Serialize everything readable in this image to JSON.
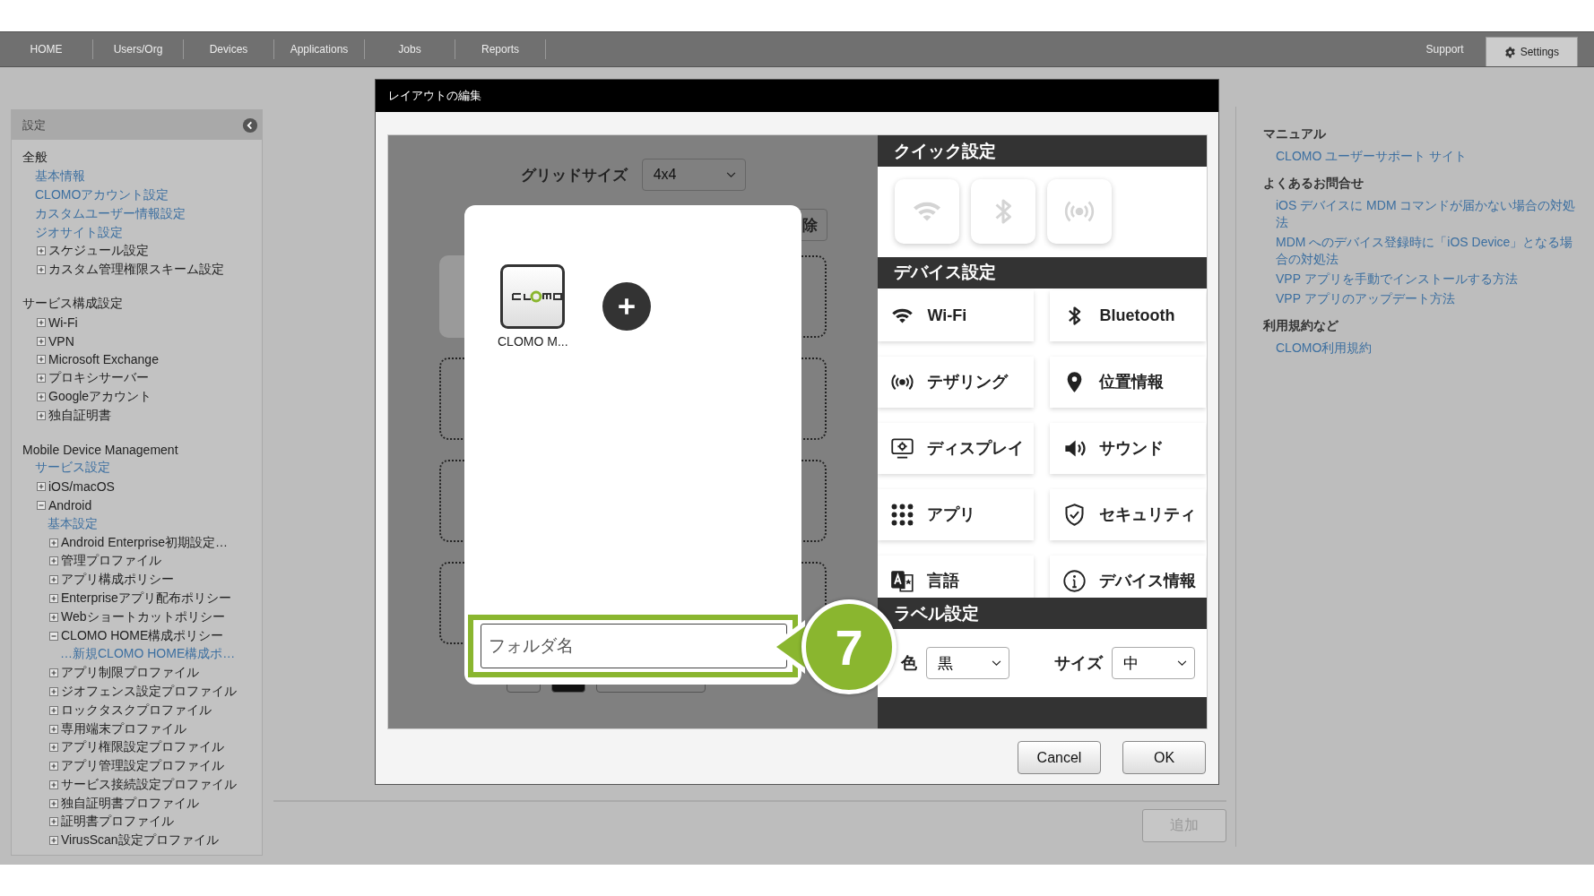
{
  "nav": {
    "tabs": [
      {
        "label": "HOME",
        "selected": false
      },
      {
        "label": "Users/Org",
        "selected": false
      },
      {
        "label": "Devices",
        "selected": false
      },
      {
        "label": "Applications",
        "selected": false
      },
      {
        "label": "Jobs",
        "selected": false
      },
      {
        "label": "Reports",
        "selected": false
      }
    ],
    "right_tabs": [
      {
        "label": "Support",
        "selected": false
      },
      {
        "label": "Settings",
        "selected": true
      }
    ]
  },
  "sidebar": {
    "title": "設定",
    "sections": [
      {
        "heading": "全般",
        "items": [
          {
            "label": "基本情報",
            "kind": "link"
          },
          {
            "label": "CLOMOアカウント設定",
            "kind": "link"
          },
          {
            "label": "カスタムユーザー情報設定",
            "kind": "link"
          },
          {
            "label": "ジオサイト設定",
            "kind": "link"
          },
          {
            "label": "スケジュール設定",
            "kind": "node",
            "expanded": false
          },
          {
            "label": "カスタム管理権限スキーム設定",
            "kind": "node",
            "expanded": false
          }
        ]
      },
      {
        "heading": "サービス構成設定",
        "items": [
          {
            "label": "Wi-Fi",
            "kind": "node",
            "expanded": false
          },
          {
            "label": "VPN",
            "kind": "node",
            "expanded": false
          },
          {
            "label": "Microsoft Exchange",
            "kind": "node",
            "expanded": false
          },
          {
            "label": "プロキシサーバー",
            "kind": "node",
            "expanded": false
          },
          {
            "label": "Googleアカウント",
            "kind": "node",
            "expanded": false
          },
          {
            "label": "独自証明書",
            "kind": "node",
            "expanded": false
          }
        ]
      },
      {
        "heading": "Mobile Device Management",
        "items": [
          {
            "label": "サービス設定",
            "kind": "link"
          },
          {
            "label": "iOS/macOS",
            "kind": "node",
            "expanded": false
          },
          {
            "label": "Android",
            "kind": "node",
            "expanded": true,
            "children": [
              {
                "label": "基本設定",
                "kind": "link"
              },
              {
                "label": "Android Enterprise初期設定…",
                "kind": "node",
                "expanded": false
              },
              {
                "label": "管理プロファイル",
                "kind": "node",
                "expanded": false
              },
              {
                "label": "アプリ構成ポリシー",
                "kind": "node",
                "expanded": false
              },
              {
                "label": "Enterpriseアプリ配布ポリシー",
                "kind": "node",
                "expanded": false
              },
              {
                "label": "Webショートカットポリシー",
                "kind": "node",
                "expanded": false
              },
              {
                "label": "CLOMO HOME構成ポリシー",
                "kind": "node",
                "expanded": true,
                "children": [
                  {
                    "label": "…新規CLOMO HOME構成ポ…",
                    "kind": "link"
                  }
                ]
              },
              {
                "label": "アプリ制限プロファイル",
                "kind": "node",
                "expanded": false
              },
              {
                "label": "ジオフェンス設定プロファイル",
                "kind": "node",
                "expanded": false
              },
              {
                "label": "ロックタスクプロファイル",
                "kind": "node",
                "expanded": false
              },
              {
                "label": "専用端末プロファイル",
                "kind": "node",
                "expanded": false
              },
              {
                "label": "アプリ権限設定プロファイル",
                "kind": "node",
                "expanded": false
              },
              {
                "label": "アプリ管理設定プロファイル",
                "kind": "node",
                "expanded": false
              },
              {
                "label": "サービス接続設定プロファイル",
                "kind": "node",
                "expanded": false
              },
              {
                "label": "独自証明書プロファイル",
                "kind": "node",
                "expanded": false
              },
              {
                "label": "証明書プロファイル",
                "kind": "node",
                "expanded": false
              },
              {
                "label": "VirusScan設定プロファイル",
                "kind": "node",
                "expanded": false
              }
            ]
          }
        ]
      }
    ]
  },
  "dialog": {
    "title": "レイアウトの編集",
    "grid_size": {
      "label": "グリッドサイズ",
      "value": "4x4"
    },
    "delete_button": "除",
    "folder": {
      "apps": [
        {
          "label": "CLOMO M..."
        }
      ],
      "name_field": {
        "placeholder": "フォルダ名"
      }
    },
    "callout": "7",
    "quick_settings": {
      "title": "クイック設定"
    },
    "device_settings": {
      "title": "デバイス設定",
      "items": [
        {
          "label": "Wi-Fi"
        },
        {
          "label": "Bluetooth"
        },
        {
          "label": "テザリング"
        },
        {
          "label": "位置情報"
        },
        {
          "label": "ディスプレイ"
        },
        {
          "label": "サウンド"
        },
        {
          "label": "アプリ"
        },
        {
          "label": "セキュリティ"
        },
        {
          "label": "言語"
        },
        {
          "label": "デバイス情報"
        }
      ]
    },
    "label_settings": {
      "title": "ラベル設定",
      "color": {
        "label": "色",
        "value": "黒"
      },
      "size": {
        "label": "サイズ",
        "value": "中"
      }
    },
    "buttons": [
      {
        "label": "Cancel"
      },
      {
        "label": "OK"
      }
    ]
  },
  "add_button": {
    "label": "追加",
    "disabled": true
  },
  "help": [
    {
      "heading": "マニュアル",
      "links": [
        "CLOMO ユーザーサポート サイト"
      ]
    },
    {
      "heading": "よくあるお問合せ",
      "links": [
        "iOS デバイスに MDM コマンドが届かない場合の対処法",
        "MDM へのデバイス登録時に「iOS Device」となる場合の対処法",
        "VPP アプリを手動でインストールする方法",
        "VPP アプリのアップデート方法"
      ]
    },
    {
      "heading": "利用規約など",
      "links": [
        "CLOMO利用規約"
      ]
    }
  ]
}
